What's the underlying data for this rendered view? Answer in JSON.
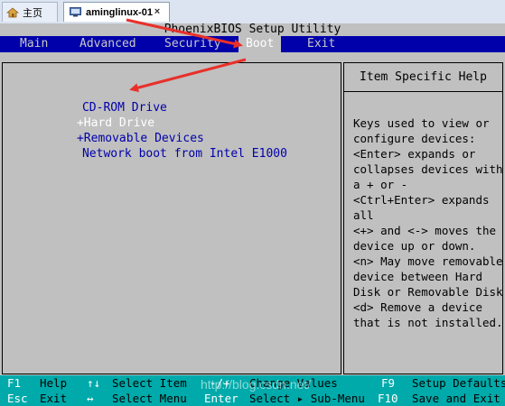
{
  "tabs": [
    {
      "label": "主页",
      "icon": "home-icon"
    },
    {
      "label": "aminglinux-01",
      "icon": "vm-icon",
      "close": "×"
    }
  ],
  "bios": {
    "title": "PhoenixBIOS Setup Utility",
    "menu": [
      "Main",
      "Advanced",
      "Security",
      "Boot",
      "Exit"
    ],
    "active_menu": "Boot",
    "boot_items": [
      {
        "prefix": "",
        "label": "CD-ROM Drive"
      },
      {
        "prefix": "+",
        "label": "Hard Drive"
      },
      {
        "prefix": "+",
        "label": "Removable Devices"
      },
      {
        "prefix": "",
        "label": "Network boot from Intel E1000"
      }
    ],
    "help_title": "Item Specific Help",
    "help_lines": [
      "Keys used to view or",
      "configure devices:",
      "<Enter> expands or",
      "collapses devices with",
      "a + or -",
      "<Ctrl+Enter> expands",
      "all",
      "<+> and <-> moves the",
      "device up or down.",
      "<n> May move removable",
      "device between Hard",
      "Disk or Removable Disk",
      "<d> Remove a device",
      "that is not installed."
    ],
    "footer": {
      "row1": [
        {
          "key": "F1",
          "desc": "Help"
        },
        {
          "key": "↑↓",
          "desc": "Select Item"
        },
        {
          "key": "-/+",
          "desc": "Change Values"
        },
        {
          "key": "F9",
          "desc": "Setup Defaults"
        }
      ],
      "row2": [
        {
          "key": "Esc",
          "desc": "Exit"
        },
        {
          "key": "↔",
          "desc": "Select Menu"
        },
        {
          "key": "Enter",
          "desc": "Select ▸ Sub-Menu"
        },
        {
          "key": "F10",
          "desc": "Save and Exit"
        }
      ]
    }
  },
  "watermark": "http://blog.csdn.net/",
  "colors": {
    "menubar": "#0000aa",
    "footer": "#00aaaa",
    "arrow": "#e8302a"
  }
}
